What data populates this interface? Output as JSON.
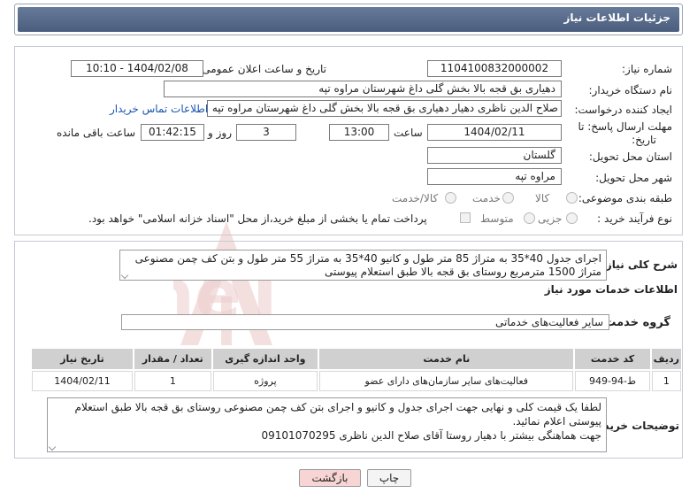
{
  "header": {
    "title": "جزئیات اطلاعات نیاز"
  },
  "fields": {
    "need_number_label": "شماره نیاز:",
    "need_number": "1104100832000002",
    "announce_label": "تاریخ و ساعت اعلان عمومی:",
    "announce_value": "1404/02/08 - 10:10",
    "buyer_org_label": "نام دستگاه خریدار:",
    "buyer_org": "دهیاری بق قجه بالا بخش گلی داغ شهرستان مراوه تپه",
    "requester_label": "ایجاد کننده درخواست:",
    "requester": "صلاح الدین ناظری دهیار دهیاری بق قجه بالا بخش گلی داغ شهرستان مراوه تپه",
    "contact_link": "اطلاعات تماس خریدار",
    "deadline_label_1": "مهلت ارسال پاسخ: تا",
    "deadline_label_2": "تاریخ:",
    "deadline_date": "1404/02/11",
    "time_label": "ساعت",
    "deadline_time": "13:00",
    "days_value": "3",
    "days_label": "روز و",
    "remaining_time": "01:42:15",
    "remaining_label": "ساعت باقی مانده",
    "province_label": "استان محل تحویل:",
    "province": "گلستان",
    "city_label": "شهر محل تحویل:",
    "city": "مراوه تپه",
    "category_label": "طبقه بندی موضوعی:",
    "category_options": [
      "کالا",
      "خدمت",
      "کالا/خدمت"
    ],
    "process_label": "نوع فرآیند خرید :",
    "process_options": [
      "جزیی",
      "متوسط"
    ],
    "payment_note": "پرداخت تمام یا بخشی از مبلغ خرید،از محل \"اسناد خزانه اسلامی\" خواهد بود."
  },
  "description": {
    "label": "شرح کلی نیاز:",
    "text": "اجرای جدول 40*35 به متراژ 85 متر طول و کانیو 40*35 به متراژ 55 متر طول و بتن کف چمن مصنوعی متراژ 1500 مترمربع روستای بق قجه بالا طبق استعلام پیوستی"
  },
  "services": {
    "section_title": "اطلاعات خدمات مورد نیاز",
    "group_label": "گروه خدمت:",
    "group_value": "سایر فعالیت‌های خدماتی",
    "columns": [
      "ردیف",
      "کد خدمت",
      "نام خدمت",
      "واحد اندازه گیری",
      "تعداد / مقدار",
      "تاریخ نیاز"
    ],
    "rows": [
      [
        "1",
        "ط-94-949",
        "فعالیت‌های سایر سازمان‌های دارای عضو",
        "پروژه",
        "1",
        "1404/02/11"
      ]
    ]
  },
  "buyer_notes": {
    "label": "توضیحات خریدار:",
    "line1": "لطفا یک قیمت کلی و نهایی جهت اجرای جدول و کانیو و اجرای بتن کف چمن مصنوعی روستای بق قجه بالا طبق استعلام پیوستی اعلام نمائید.",
    "line2": "جهت هماهنگی بیشتر با دهیار روستا آقای صلاح الدین ناظری 09101070295"
  },
  "buttons": {
    "print": "چاپ",
    "back": "بازگشت"
  },
  "watermark": {
    "text": "AriaTender.neT"
  },
  "colors": {
    "header": "#5a6d8c",
    "link": "#1a55b0",
    "watermark": "#e9c3c3"
  }
}
